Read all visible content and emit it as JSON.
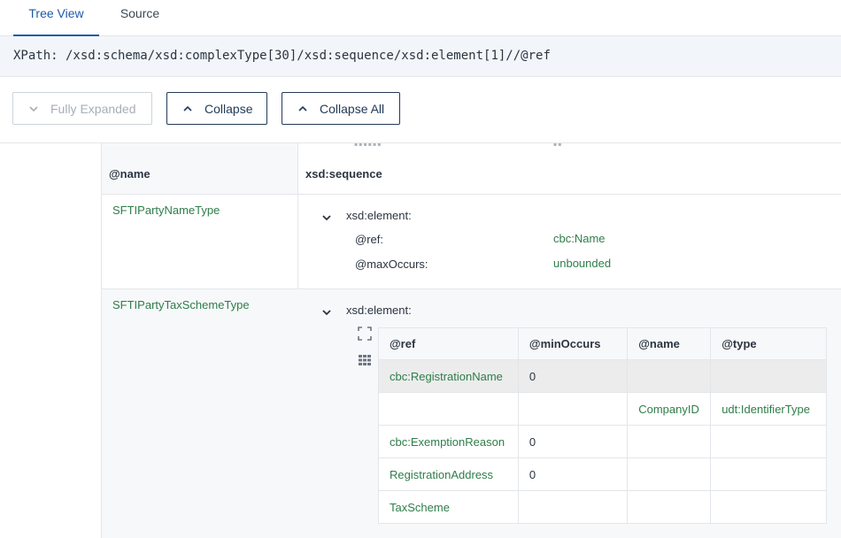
{
  "tabs": [
    {
      "label": "Tree View",
      "active": true
    },
    {
      "label": "Source",
      "active": false
    }
  ],
  "xpath": "XPath: /xsd:schema/xsd:complexType[30]/xsd:sequence/xsd:element[1]//@ref",
  "toolbar": {
    "fully_expanded": "Fully Expanded",
    "collapse": "Collapse",
    "collapse_all": "Collapse All"
  },
  "tree": {
    "header": {
      "name": "@name",
      "sequence": "xsd:sequence"
    },
    "rows": [
      {
        "name": "SFTIPartyNameType",
        "element_label": "xsd:element:",
        "attrs": [
          {
            "label": "@ref:",
            "value": "cbc:Name"
          },
          {
            "label": "@maxOccurs:",
            "value": "unbounded"
          }
        ]
      },
      {
        "name": "SFTIPartyTaxSchemeType",
        "element_label": "xsd:element:",
        "table": {
          "columns": [
            "@ref",
            "@minOccurs",
            "@name",
            "@type"
          ],
          "rows": [
            [
              "cbc:RegistrationName",
              "0",
              "",
              ""
            ],
            [
              "",
              "",
              "CompanyID",
              "udt:IdentifierType"
            ],
            [
              "cbc:ExemptionReason",
              "0",
              "",
              ""
            ],
            [
              "RegistrationAddress",
              "0",
              "",
              ""
            ],
            [
              "TaxScheme",
              "",
              "",
              ""
            ]
          ]
        }
      }
    ]
  },
  "colors": {
    "accent": "#1e5aa8",
    "link": "#2e7d4a",
    "border": "#e3e6ea"
  }
}
